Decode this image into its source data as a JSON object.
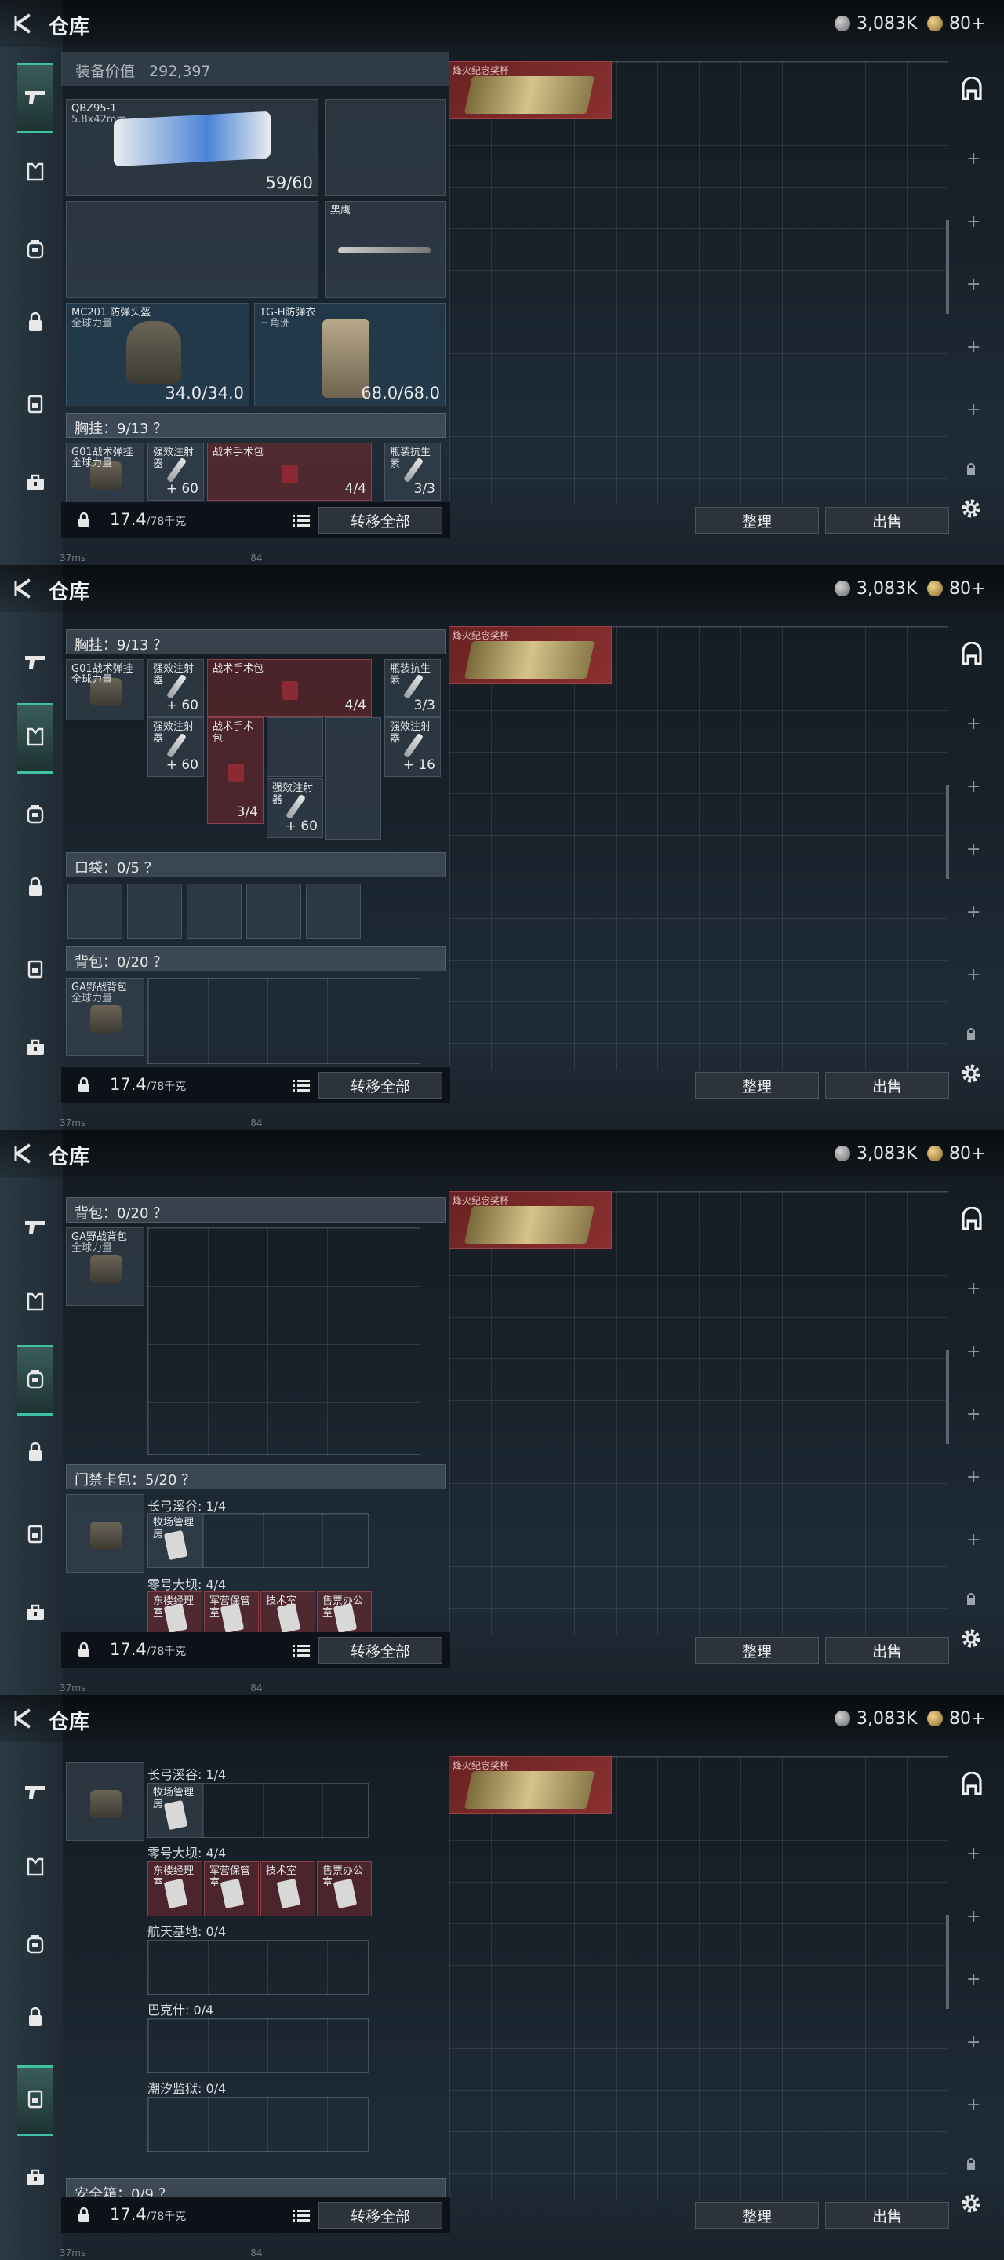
{
  "header": {
    "back_label": "",
    "title": "仓库",
    "currency1": "3,083K",
    "currency2": "80+"
  },
  "sidebar": {
    "items": [
      "weapons",
      "armor",
      "backpack",
      "lock-item",
      "keycard",
      "safebox"
    ]
  },
  "equip": {
    "value_label": "装备价值",
    "value": "292,397"
  },
  "weapon1": {
    "name": "QBZ95-1",
    "ammo": "5.8x42mm",
    "count": "59/60"
  },
  "knife": {
    "name": "黑鹰"
  },
  "helmet": {
    "name": "MC201 防弹头盔",
    "sub": "全球力量",
    "count": "34.0/34.0"
  },
  "armor": {
    "name": "TG-H防弹衣",
    "sub": "三角洲",
    "count": "68.0/68.0"
  },
  "chest": {
    "title": "胸挂：9/13 ？",
    "rig_name": "G01战术弹挂",
    "rig_sub": "全球力量",
    "items": [
      {
        "name": "强效注射器",
        "count": "+ 60"
      },
      {
        "name": "战术手术包",
        "count": "4/4"
      },
      {
        "name": "瓶装抗生素",
        "count": "3/3"
      },
      {
        "name": "强效注射器",
        "count": "+ 60"
      },
      {
        "name": "战术手术包",
        "count": "3/4"
      },
      {
        "name": "强效注射器",
        "count": "+ 60"
      },
      {
        "name": "强效注射器",
        "count": "+ 16"
      }
    ]
  },
  "pocket": {
    "title": "口袋：0/5 ？"
  },
  "backpack": {
    "title": "背包：0/20 ？",
    "name": "GA野战背包",
    "sub": "全球力量"
  },
  "cardpack": {
    "title": "门禁卡包：5/20 ？",
    "zones": [
      {
        "label": "长弓溪谷: 1/4",
        "cards": [
          "牧场管理房"
        ]
      },
      {
        "label": "零号大坝: 4/4",
        "cards": [
          "东楼经理室",
          "军营保管室",
          "技术室",
          "售票办公室"
        ]
      },
      {
        "label": "航天基地: 0/4"
      },
      {
        "label": "巴克什: 0/4"
      },
      {
        "label": "潮汐监狱: 0/4"
      }
    ]
  },
  "safebox": {
    "title": "安全箱：0/9 ？"
  },
  "footer": {
    "weight": "17.4",
    "weight_max": "/78千克",
    "transfer": "转移全部",
    "sort": "整理",
    "sell": "出售"
  },
  "warehouse": {
    "trophy": "烽火纪念奖杯"
  },
  "status": {
    "ping": "37ms",
    "fps": "84"
  },
  "colors": {
    "accent": "#3fc1a6",
    "trophy": "#8a3030"
  }
}
